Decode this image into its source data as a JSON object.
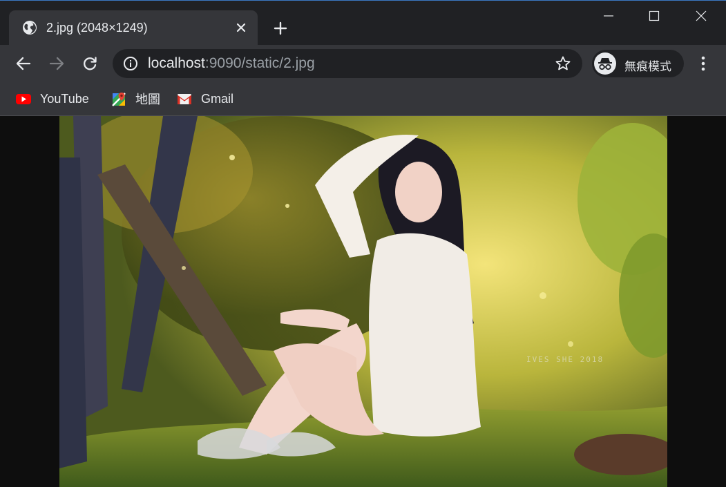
{
  "tab": {
    "title": "2.jpg (2048×1249)",
    "favicon": "globe-icon",
    "close_icon": "close-icon"
  },
  "window": {
    "minimize_icon": "minimize-icon",
    "maximize_icon": "maximize-icon",
    "close_icon": "window-close-icon"
  },
  "toolbar": {
    "back_icon": "back-arrow-icon",
    "forward_icon": "forward-arrow-icon",
    "reload_icon": "reload-icon",
    "url_host": "localhost",
    "url_rest": ":9090/static/2.jpg",
    "info_icon": "info-icon",
    "star_icon": "star-icon",
    "incognito_label": "無痕模式",
    "menu_icon": "kebab-menu-icon"
  },
  "bookmarks": [
    {
      "label": "YouTube",
      "icon": "youtube-icon"
    },
    {
      "label": "地圖",
      "icon": "maps-icon"
    },
    {
      "label": "Gmail",
      "icon": "gmail-icon"
    }
  ],
  "image": {
    "watermark": "IVES SHE 2018"
  },
  "colors": {
    "titlebar": "#202124",
    "toolbar": "#35363a",
    "omnibox": "#202124",
    "viewport": "#0e0e0e",
    "accent_border": "#3b78c4"
  }
}
